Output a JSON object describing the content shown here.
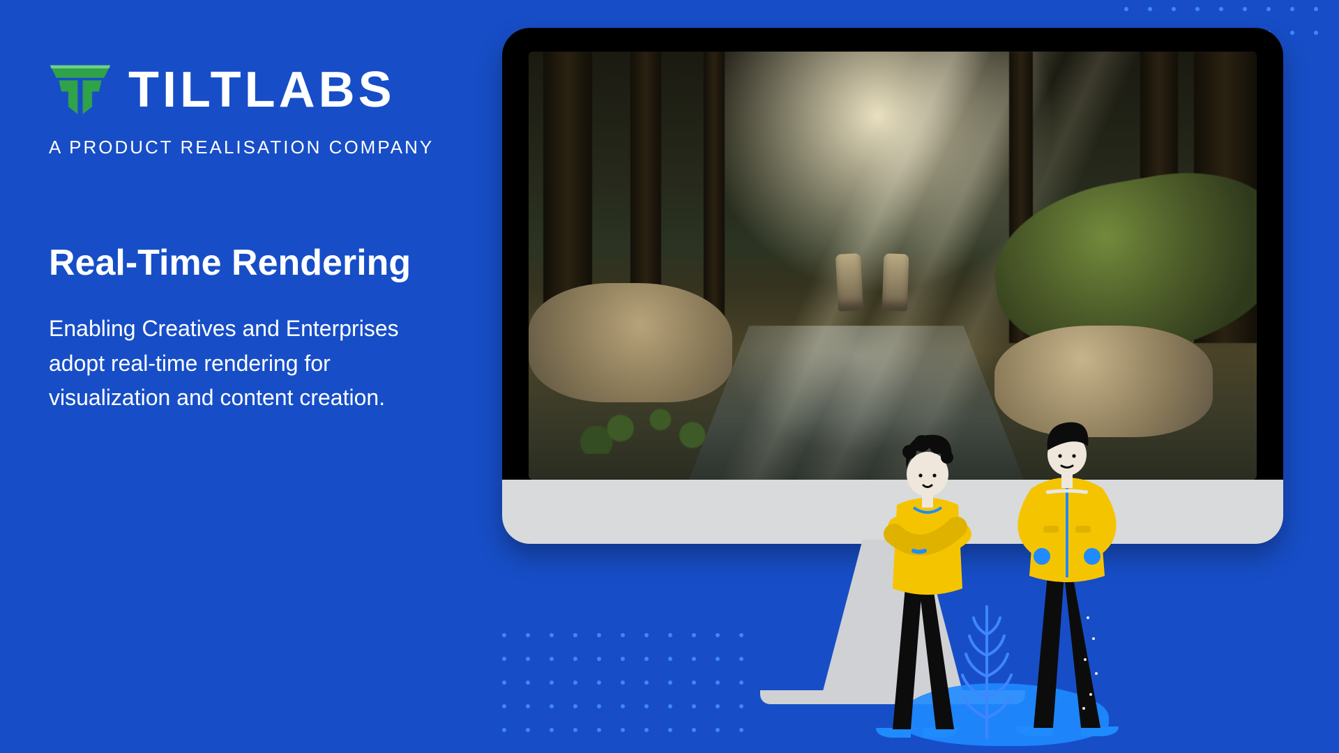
{
  "brand": {
    "name": "TILTLABS",
    "tagline": "A PRODUCT REALISATION COMPANY"
  },
  "hero": {
    "headline": "Real-Time Rendering",
    "body": "Enabling Creatives and Enterprises adopt real-time rendering for visualization and content creation."
  },
  "icons": {
    "logo": "tiltlabs-logo"
  },
  "colors": {
    "bg": "#174ec7",
    "accent": "#30a24a",
    "dot": "#3f86ff",
    "shirt": "#f5c400"
  }
}
